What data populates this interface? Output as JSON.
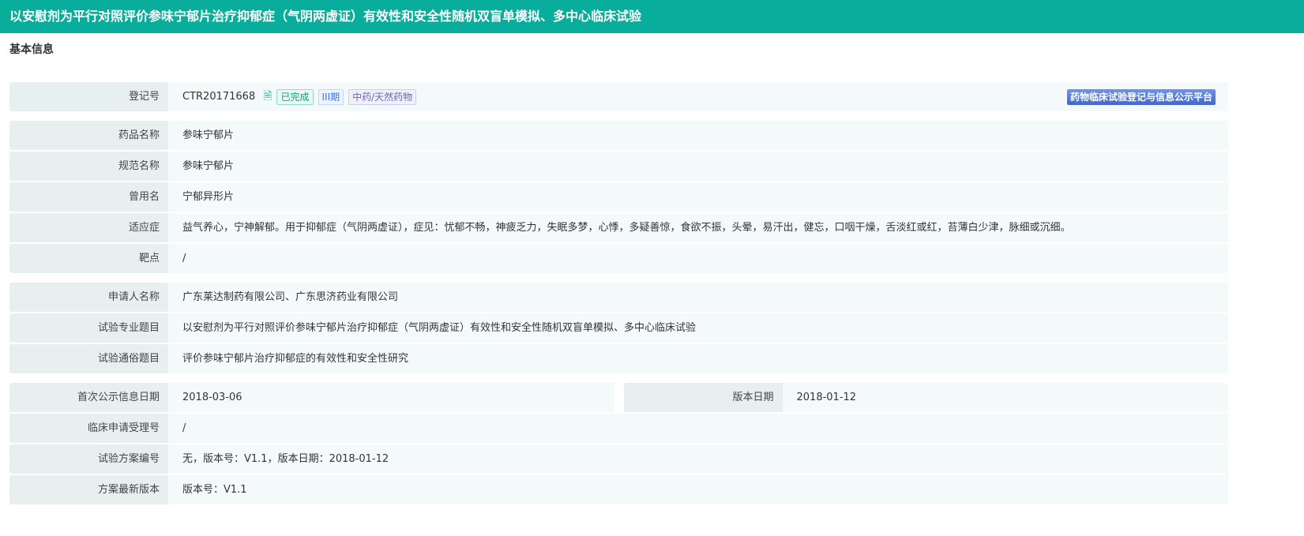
{
  "header": {
    "title": "以安慰剂为平行对照评价参味宁郁片治疗抑郁症（气阴两虚证）有效性和安全性随机双盲单模拟、多中心临床试验"
  },
  "section": "基本信息",
  "reg": {
    "label": "登记号",
    "value": "CTR20171668",
    "tags": [
      "已完成",
      "III期",
      "中药/天然药物"
    ],
    "platform": "药物临床试验登记与信息公示平台"
  },
  "drug": [
    {
      "label": "药品名称",
      "value": "参味宁郁片"
    },
    {
      "label": "规范名称",
      "value": "参味宁郁片"
    },
    {
      "label": "曾用名",
      "value": "宁郁异形片"
    },
    {
      "label": "适应症",
      "value": "益气养心，宁神解郁。用于抑郁症（气阴两虚证），症见：忧郁不畅，神疲乏力，失眠多梦，心悸，多疑善惊，食欲不振，头晕，易汗出，健忘，口咽干燥，舌淡红或红，苔薄白少津，脉细或沉细。"
    },
    {
      "label": "靶点",
      "value": "/"
    }
  ],
  "applicant": [
    {
      "label": "申请人名称",
      "value": "广东莱达制药有限公司、广东思济药业有限公司"
    },
    {
      "label": "试验专业题目",
      "value": "以安慰剂为平行对照评价参味宁郁片治疗抑郁症（气阴两虚证）有效性和安全性随机双盲单模拟、多中心临床试验"
    },
    {
      "label": "试验通俗题目",
      "value": "评价参味宁郁片治疗抑郁症的有效性和安全性研究"
    }
  ],
  "dates": {
    "first_label": "首次公示信息日期",
    "first_value": "2018-03-06",
    "version_label": "版本日期",
    "version_value": "2018-01-12"
  },
  "other": [
    {
      "label": "临床申请受理号",
      "value": "/"
    },
    {
      "label": "试验方案编号",
      "value": "无，版本号：V1.1，版本日期：2018-01-12"
    },
    {
      "label": "方案最新版本",
      "value": "版本号：V1.1"
    }
  ]
}
